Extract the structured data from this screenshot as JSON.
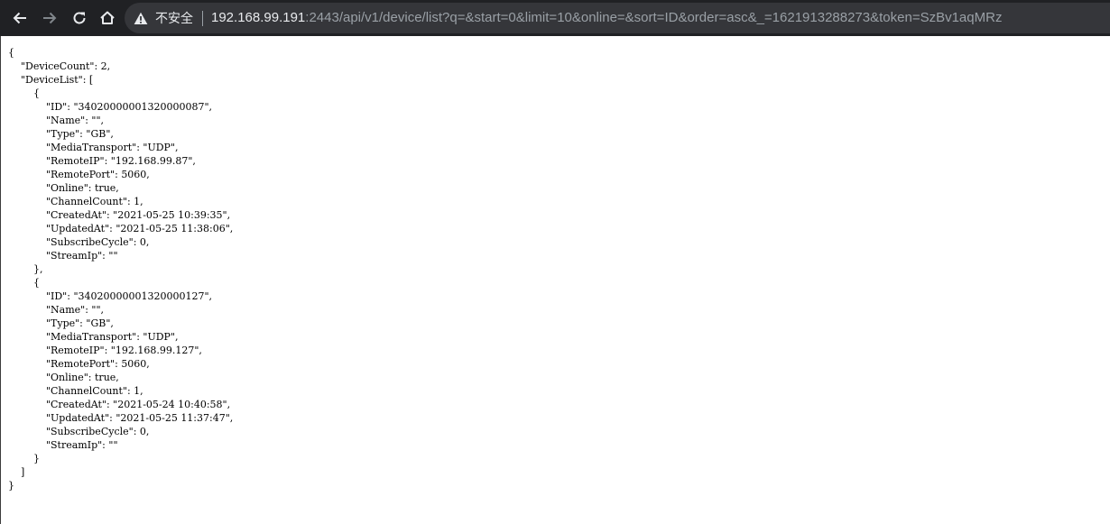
{
  "browser": {
    "toolbar_color": "#202124",
    "omnibox_color": "#35363a",
    "security_label": "不安全",
    "url_host": "192.168.99.191",
    "url_rest": ":2443/api/v1/device/list?q=&start=0&limit=10&online=&sort=ID&order=asc&_=1621913288273&token=SzBv1aqMRz"
  },
  "response": {
    "raw_text": "{\n    \"DeviceCount\": 2,\n    \"DeviceList\": [\n        {\n            \"ID\": \"34020000001320000087\",\n            \"Name\": \"\",\n            \"Type\": \"GB\",\n            \"MediaTransport\": \"UDP\",\n            \"RemoteIP\": \"192.168.99.87\",\n            \"RemotePort\": 5060,\n            \"Online\": true,\n            \"ChannelCount\": 1,\n            \"CreatedAt\": \"2021-05-25 10:39:35\",\n            \"UpdatedAt\": \"2021-05-25 11:38:06\",\n            \"SubscribeCycle\": 0,\n            \"StreamIp\": \"\"\n        },\n        {\n            \"ID\": \"34020000001320000127\",\n            \"Name\": \"\",\n            \"Type\": \"GB\",\n            \"MediaTransport\": \"UDP\",\n            \"RemoteIP\": \"192.168.99.127\",\n            \"RemotePort\": 5060,\n            \"Online\": true,\n            \"ChannelCount\": 1,\n            \"CreatedAt\": \"2021-05-24 10:40:58\",\n            \"UpdatedAt\": \"2021-05-25 11:37:47\",\n            \"SubscribeCycle\": 0,\n            \"StreamIp\": \"\"\n        }\n    ]\n}"
  }
}
